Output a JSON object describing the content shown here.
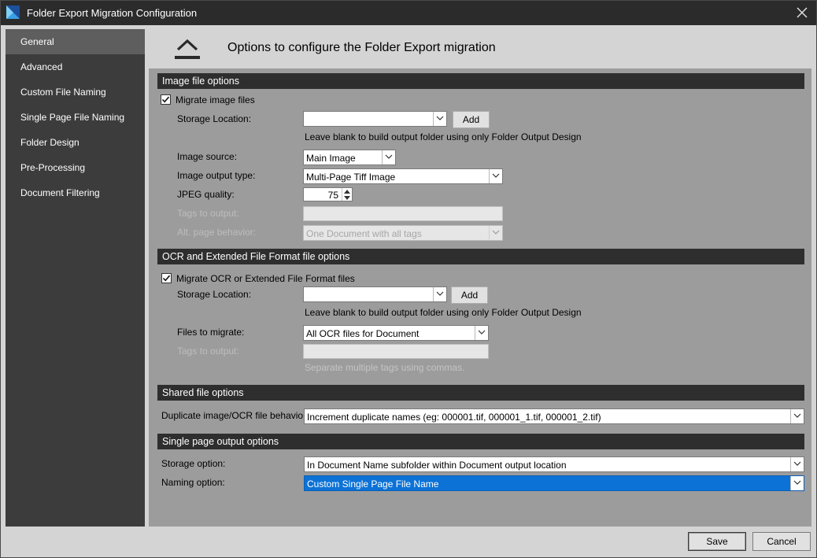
{
  "window": {
    "title": "Folder Export Migration Configuration"
  },
  "sidebar": {
    "items": [
      {
        "label": "General",
        "active": true
      },
      {
        "label": "Advanced"
      },
      {
        "label": "Custom File Naming"
      },
      {
        "label": "Single Page File Naming"
      },
      {
        "label": "Folder Design"
      },
      {
        "label": "Pre-Processing"
      },
      {
        "label": "Document Filtering"
      }
    ]
  },
  "header": {
    "title": "Options to configure the Folder Export migration",
    "icon": "export-icon"
  },
  "image_section": {
    "title": "Image file options",
    "migrate_label": "Migrate image files",
    "migrate_checked": true,
    "storage_label": "Storage Location:",
    "storage_value": "",
    "add_label": "Add",
    "storage_hint": "Leave blank to build output folder using only Folder Output Design",
    "source_label": "Image source:",
    "source_value": "Main Image",
    "output_type_label": "Image output type:",
    "output_type_value": "Multi-Page Tiff Image",
    "jpeg_label": "JPEG quality:",
    "jpeg_value": "75",
    "tags_label": "Tags to output:",
    "tags_value": "",
    "alt_label": "Alt. page behavior:",
    "alt_value": "One Document with all tags"
  },
  "ocr_section": {
    "title": "OCR and Extended File Format file options",
    "migrate_label": "Migrate OCR or Extended File Format files",
    "migrate_checked": true,
    "storage_label": "Storage Location:",
    "storage_value": "",
    "add_label": "Add",
    "storage_hint": "Leave blank to build output folder using only Folder Output Design",
    "files_label": "Files to migrate:",
    "files_value": "All OCR files for Document",
    "tags_label": "Tags to output:",
    "tags_value": "",
    "tags_hint": "Separate multiple tags using commas."
  },
  "shared_section": {
    "title": "Shared file options",
    "duplicate_label": "Duplicate image/OCR file behavior:",
    "duplicate_value": "Increment duplicate names (eg: 000001.tif, 000001_1.tif, 000001_2.tif)"
  },
  "single_section": {
    "title": "Single page output options",
    "storage_label": "Storage option:",
    "storage_value": "In Document Name subfolder within Document output location",
    "naming_label": "Naming option:",
    "naming_value": "Custom Single Page File Name"
  },
  "footer": {
    "save_label": "Save",
    "cancel_label": "Cancel"
  },
  "colors": {
    "titlebar": "#2b2b2b",
    "sidebar": "#3c3c3c",
    "sidebar_active": "#5e5e5e",
    "panel": "#9c9c9c",
    "section_header": "#2e2e2e",
    "selection": "#0c72d6"
  }
}
